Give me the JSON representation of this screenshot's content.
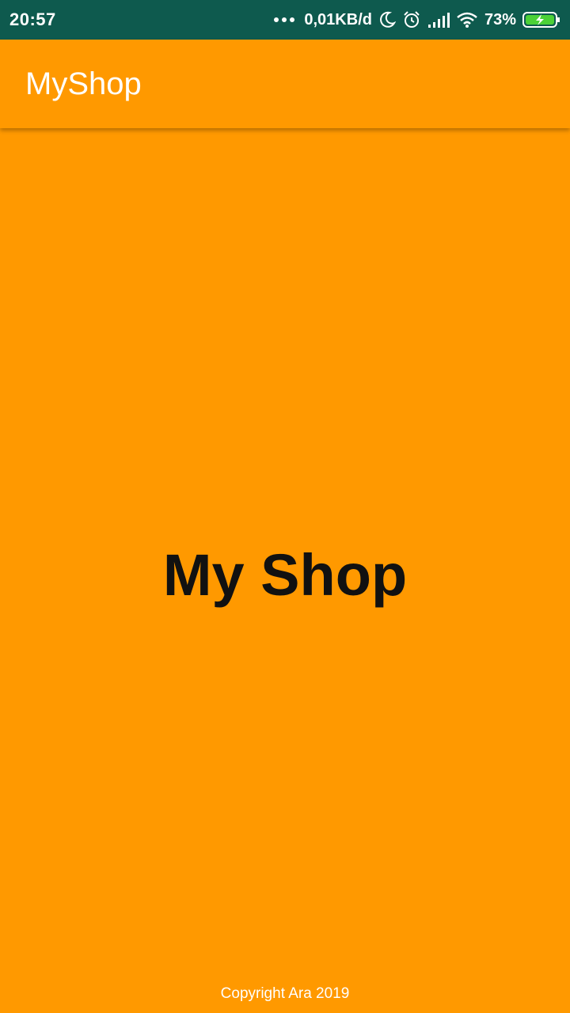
{
  "status_bar": {
    "time": "20:57",
    "network_speed": "0,01KB/d",
    "battery_percent": "73%",
    "icons": [
      "more-dots-icon",
      "moon-icon",
      "alarm-icon",
      "signal-icon",
      "wifi-icon",
      "battery-charging-icon"
    ]
  },
  "app_bar": {
    "title": "MyShop"
  },
  "main": {
    "title": "My Shop"
  },
  "footer": {
    "copyright": "Copyright Ara 2019"
  },
  "colors": {
    "status_bar": "#0E5A4E",
    "primary": "#FF9900",
    "battery_fill": "#4CD137"
  }
}
